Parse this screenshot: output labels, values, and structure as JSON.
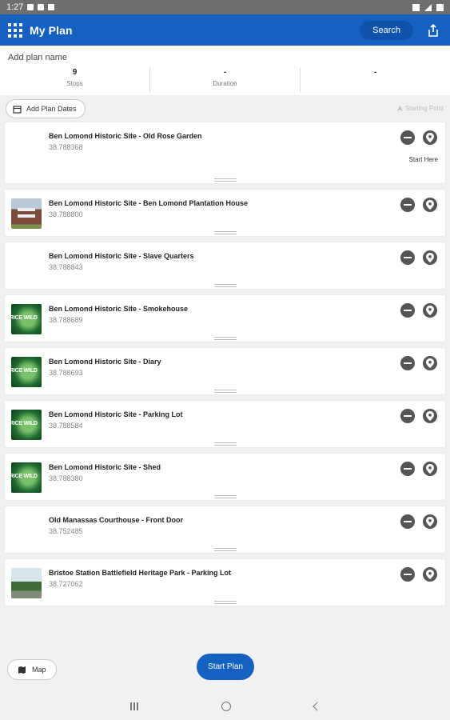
{
  "status_bar": {
    "time": "1:27"
  },
  "app_bar": {
    "title": "My Plan",
    "search_label": "Search"
  },
  "plan": {
    "name_placeholder": "Add plan name",
    "stats": [
      {
        "value": "9",
        "label": "Stops"
      },
      {
        "value": "-",
        "label": "Duration"
      },
      {
        "value": "-",
        "label": ""
      }
    ]
  },
  "controls": {
    "add_dates_label": "Add Plan Dates",
    "starting_point_label": "Starting Point"
  },
  "stops": [
    {
      "title": "Ben Lomond Historic Site - Old Rose Garden",
      "coord": "38.788368",
      "thumb": "none",
      "note": "Start Here"
    },
    {
      "title": "Ben Lomond Historic Site - Ben Lomond Plantation House",
      "coord": "38.788800",
      "thumb": "house",
      "note": ""
    },
    {
      "title": "Ben Lomond Historic Site - Slave Quarters",
      "coord": "38.788843",
      "thumb": "none",
      "note": ""
    },
    {
      "title": "Ben Lomond Historic Site - Smokehouse",
      "coord": "38.788689",
      "thumb": "green",
      "note": ""
    },
    {
      "title": "Ben Lomond Historic Site - Diary",
      "coord": "38.788693",
      "thumb": "green",
      "note": ""
    },
    {
      "title": "Ben Lomond Historic Site - Parking Lot",
      "coord": "38.788584",
      "thumb": "green",
      "note": ""
    },
    {
      "title": "Ben Lomond Historic Site - Shed",
      "coord": "38.788380",
      "thumb": "green",
      "note": ""
    },
    {
      "title": "Old Manassas Courthouse - Front Door",
      "coord": "38.752485",
      "thumb": "none",
      "note": ""
    },
    {
      "title": "Bristoe Station Battlefield Heritage Park - Parking Lot",
      "coord": "38.727062",
      "thumb": "field",
      "note": ""
    }
  ],
  "thumb_overlay_text": "RICE WILD",
  "bottom": {
    "map_label": "Map",
    "start_label": "Start Plan"
  },
  "colors": {
    "primary": "#1461c2",
    "background": "#f1f1f3",
    "icon_dark": "#555555"
  }
}
